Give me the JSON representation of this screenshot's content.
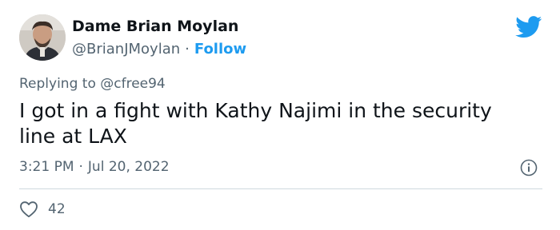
{
  "author": {
    "display_name": "Dame Brian Moylan",
    "handle": "@BrianJMoylan",
    "separator": "·",
    "follow_label": "Follow",
    "avatar_icon": "avatar-photo"
  },
  "reply": {
    "prefix": "Replying to",
    "mention": "@cfree94"
  },
  "tweet": {
    "text": "I got in a fight with Kathy Najimi in the security line at LAX"
  },
  "meta": {
    "time": "3:21 PM",
    "separator": "·",
    "date": "Jul 20, 2022",
    "info_icon": "info-icon"
  },
  "engagement": {
    "like_icon": "heart-icon",
    "like_count": "42"
  },
  "colors": {
    "accent": "#1d9bf0",
    "text": "#0f1419",
    "muted": "#536471",
    "divider": "#cfd9de"
  },
  "logo_icon": "twitter-bird-icon"
}
